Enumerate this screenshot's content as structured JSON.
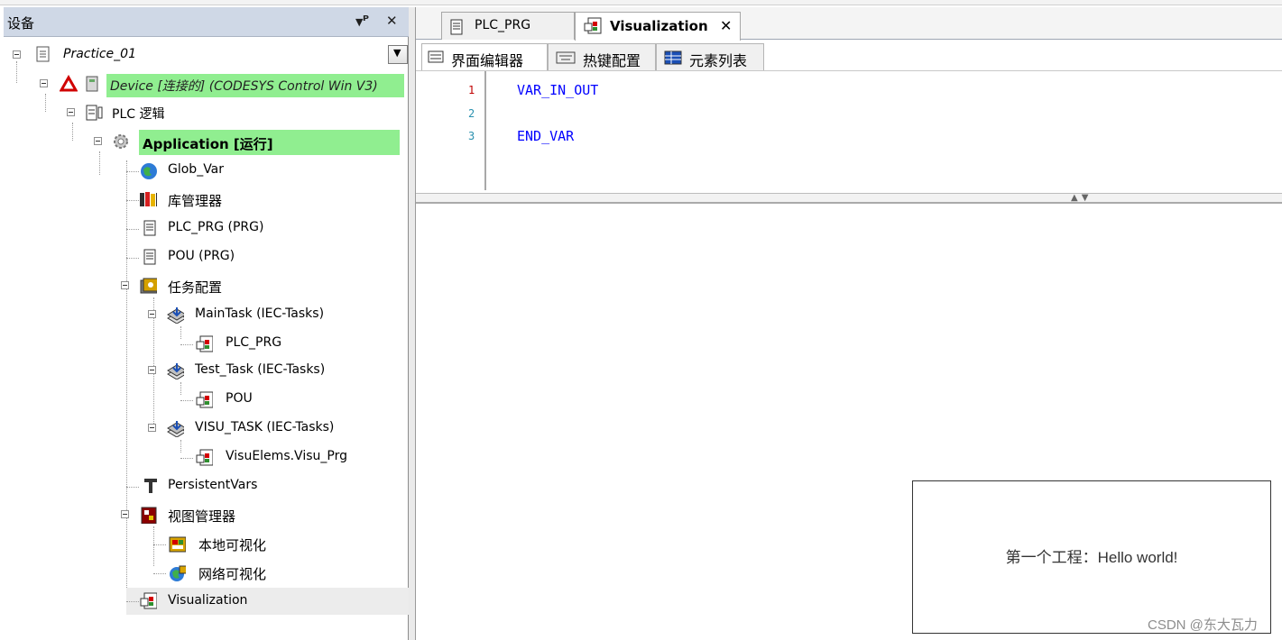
{
  "device_panel": {
    "title": "设备",
    "root": "Practice_01",
    "items": [
      {
        "key": "device",
        "label": "Device [连接的] (CODESYS Control Win V3)"
      },
      {
        "key": "plc_logic",
        "label": "PLC 逻辑"
      },
      {
        "key": "application",
        "label": "Application [运行]"
      },
      {
        "key": "glob_var",
        "label": "Glob_Var"
      },
      {
        "key": "lib_manager",
        "label": "库管理器"
      },
      {
        "key": "plc_prg",
        "label": "PLC_PRG (PRG)"
      },
      {
        "key": "pou",
        "label": "POU (PRG)"
      },
      {
        "key": "task_config",
        "label": "任务配置"
      },
      {
        "key": "main_task",
        "label": "MainTask (IEC-Tasks)"
      },
      {
        "key": "main_task_call",
        "label": "PLC_PRG"
      },
      {
        "key": "test_task",
        "label": "Test_Task (IEC-Tasks)"
      },
      {
        "key": "test_task_call",
        "label": "POU"
      },
      {
        "key": "visu_task",
        "label": "VISU_TASK (IEC-Tasks)"
      },
      {
        "key": "visu_task_call",
        "label": "VisuElems.Visu_Prg"
      },
      {
        "key": "persistent_vars",
        "label": "PersistentVars"
      },
      {
        "key": "visu_manager",
        "label": "视图管理器"
      },
      {
        "key": "target_visu",
        "label": "本地可视化"
      },
      {
        "key": "web_visu",
        "label": "网络可视化"
      },
      {
        "key": "visualization",
        "label": "Visualization"
      }
    ]
  },
  "editor": {
    "tabs": [
      {
        "label": "PLC_PRG"
      },
      {
        "label": "Visualization"
      }
    ],
    "subtabs": [
      {
        "label": "界面编辑器"
      },
      {
        "label": "热键配置"
      },
      {
        "label": "元素列表"
      }
    ],
    "code_lines": [
      {
        "num": "1",
        "text": "VAR_IN_OUT"
      },
      {
        "num": "2",
        "text": ""
      },
      {
        "num": "3",
        "text": "END_VAR"
      }
    ],
    "visu_text": "第一个工程：Hello world!"
  },
  "watermark": "CSDN @东大瓦力",
  "colors": {
    "active_highlight": "#90ee90",
    "selected_row": "#ececec",
    "keyword": "#0000ff",
    "panel_header": "#cfd8e6"
  }
}
